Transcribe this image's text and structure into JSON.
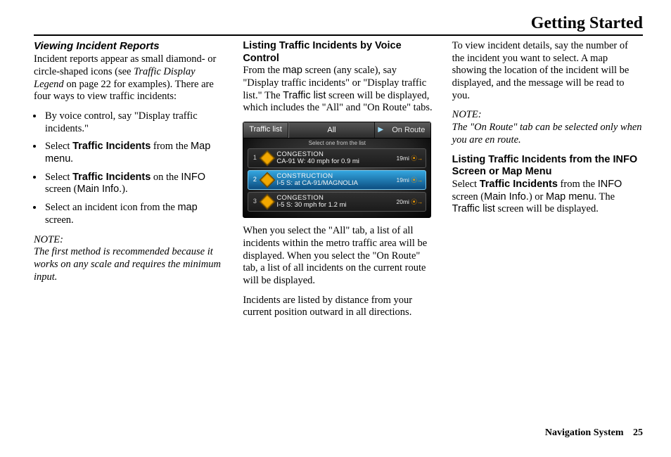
{
  "header": {
    "title": "Getting Started"
  },
  "col1": {
    "subhead": "Viewing Incident Reports",
    "intro_a": "Incident reports appear as small diamond- or circle-shaped icons (see ",
    "intro_em": "Traffic Display Legend",
    "intro_b": " on page 22 for examples). There are four ways to view traffic incidents:",
    "bullets": {
      "b1": "By voice control, say \"Display traffic incidents.\"",
      "b2_a": "Select ",
      "b2_bold": "Traffic Incidents",
      "b2_b": " from the ",
      "b2_sans": "Map menu",
      "b2_c": ".",
      "b3_a": "Select ",
      "b3_bold": "Traffic Incidents",
      "b3_b": " on the ",
      "b3_sans": "INFO",
      "b3_c": " screen (",
      "b3_sans2": "Main Info.",
      "b3_d": ").",
      "b4_a": "Select an incident icon from the ",
      "b4_sans": "map",
      "b4_b": " screen."
    },
    "noteLabel": "NOTE:",
    "noteBody": "The first method is recommended because it works on any scale and requires the minimum input."
  },
  "col2": {
    "heading": "Listing Traffic Incidents by Voice Control",
    "p1_a": "From the ",
    "p1_sans": "map",
    "p1_b": " screen (any scale), say \"Display traffic incidents\" or \"Display traffic list.\" The ",
    "p1_sans2": "Traffic list",
    "p1_c": " screen will be displayed, which includes the \"All\" and \"On Route\" tabs.",
    "screenshot": {
      "title": "Traffic list",
      "tabAll": "All",
      "tabOnRoute": "On Route",
      "subtitle": "Select one from the list",
      "rows": [
        {
          "num": "1",
          "type": "CONGESTION",
          "detail": "CA-91 W: 40 mph for 0.9 mi",
          "dist": "19mi"
        },
        {
          "num": "2",
          "type": "CONSTRUCTION",
          "detail": "I-5 S: at CA-91/MAGNOLIA",
          "dist": "19mi"
        },
        {
          "num": "3",
          "type": "CONGESTION",
          "detail": "I-5 S: 30 mph for 1.2 mi",
          "dist": "20mi"
        }
      ]
    },
    "p2": "When you select the \"All\" tab, a list of all incidents within the metro traffic area will be displayed. When you select the \"On Route\" tab, a list of all incidents on the current route will be displayed.",
    "p3": "Incidents are listed by distance from your current position outward in all directions."
  },
  "col3": {
    "p1": "To view incident details, say the number of the incident you want to select. A map showing the location of the incident will be displayed, and the message will be read to you.",
    "noteLabel": "NOTE:",
    "noteBody": "The \"On Route\" tab can be selected only when you are en route.",
    "heading": "Listing Traffic Incidents from the INFO Screen or Map Menu",
    "p2_a": "Select ",
    "p2_bold": "Traffic Incidents",
    "p2_b": " from the ",
    "p2_sans1": "INFO",
    "p2_c": " screen (",
    "p2_sans2": "Main Info.",
    "p2_d": ") or ",
    "p2_sans3": "Map menu",
    "p2_e": ". The ",
    "p2_sans4": "Traffic list",
    "p2_f": " screen will be displayed."
  },
  "footer": {
    "label": "Navigation System",
    "page": "25"
  }
}
